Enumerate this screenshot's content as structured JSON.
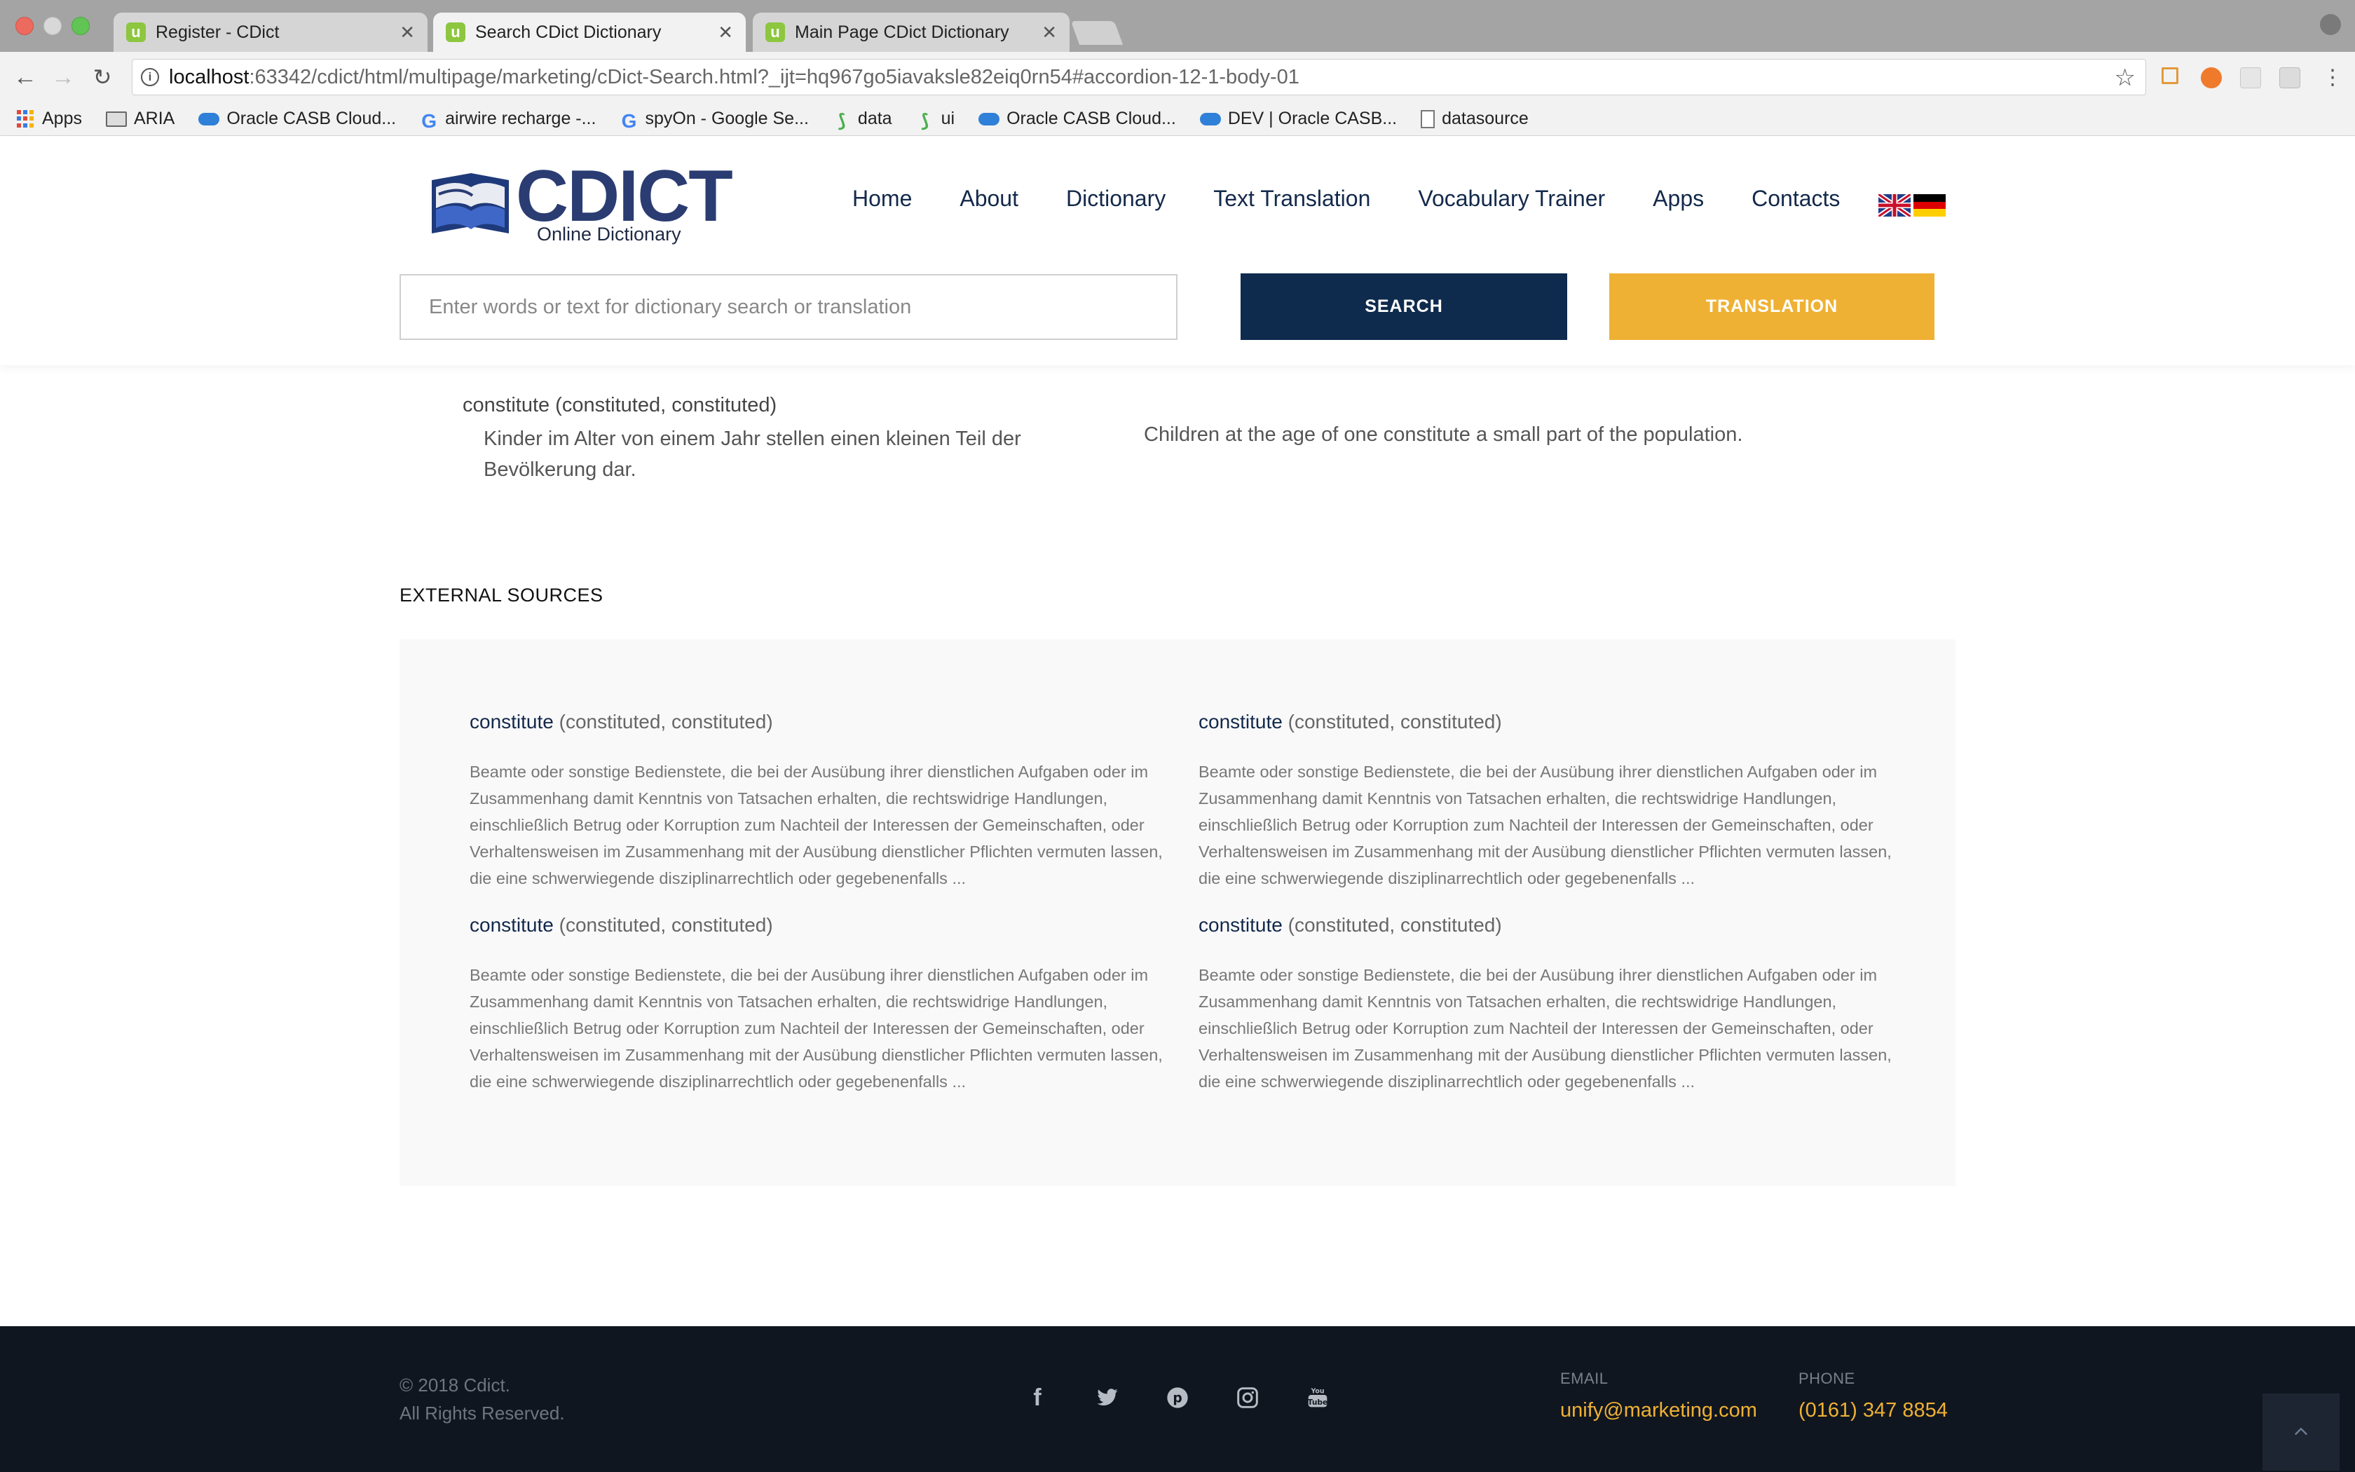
{
  "browser": {
    "tabs": [
      {
        "title": "Register - CDict",
        "active": false
      },
      {
        "title": "Search CDict Dictionary",
        "active": true
      },
      {
        "title": "Main Page CDict Dictionary",
        "active": false
      }
    ],
    "url_host": "localhost",
    "url_rest": ":63342/cdict/html/multipage/marketing/cDict-Search.html?_ijt=hq967go5iavaksle82eiq0rn54#accordion-12-1-body-01",
    "bookmarks": [
      {
        "label": "Apps",
        "icon": "apps-grid-icon"
      },
      {
        "label": "ARIA",
        "icon": "folder-icon"
      },
      {
        "label": "Oracle CASB Cloud...",
        "icon": "cloud-icon"
      },
      {
        "label": "airwire recharge -...",
        "icon": "google-icon"
      },
      {
        "label": "spyOn - Google Se...",
        "icon": "google-icon"
      },
      {
        "label": "data",
        "icon": "gitpod-icon"
      },
      {
        "label": "ui",
        "icon": "gitpod-icon"
      },
      {
        "label": "Oracle CASB Cloud...",
        "icon": "cloud-icon"
      },
      {
        "label": "DEV | Oracle CASB...",
        "icon": "cloud-icon"
      },
      {
        "label": "datasource",
        "icon": "document-icon"
      }
    ]
  },
  "site": {
    "logo_text": "CDICT",
    "logo_sub": "Online Dictionary",
    "nav": [
      "Home",
      "About",
      "Dictionary",
      "Text Translation",
      "Vocabulary Trainer",
      "Apps",
      "Contacts"
    ],
    "search_placeholder": "Enter words or text for dictionary search or translation",
    "search_label": "SEARCH",
    "translation_label": "TRANSLATION"
  },
  "result": {
    "head": "constitute (constituted, constituted)",
    "example_de": "Kinder im Alter von einem Jahr stellen einen kleinen Teil der Bevölkerung dar.",
    "example_en": "Children at the age of one constitute a small part of the population."
  },
  "external": {
    "title": "EXTERNAL SOURCES",
    "items": [
      {
        "word": "constitute",
        "forms": "(constituted, constituted)",
        "body": "Beamte oder sonstige Bedienstete, die bei der Ausübung ihrer dienstlichen Aufgaben oder im Zusammenhang damit Kenntnis von Tatsachen erhalten, die rechtswidrige Handlungen, einschließlich Betrug oder Korruption zum Nachteil der Interessen der Gemeinschaften, oder Verhaltensweisen im Zusammenhang mit der Ausübung dienstlicher Pflichten vermuten lassen, die eine schwerwiegende disziplinarrechtlich oder gegebenenfalls ..."
      },
      {
        "word": "constitute",
        "forms": "(constituted, constituted)",
        "body": "Beamte oder sonstige Bedienstete, die bei der Ausübung ihrer dienstlichen Aufgaben oder im Zusammenhang damit Kenntnis von Tatsachen erhalten, die rechtswidrige Handlungen, einschließlich Betrug oder Korruption zum Nachteil der Interessen der Gemeinschaften, oder Verhaltensweisen im Zusammenhang mit der Ausübung dienstlicher Pflichten vermuten lassen, die eine schwerwiegende disziplinarrechtlich oder gegebenenfalls ..."
      },
      {
        "word": "constitute",
        "forms": "(constituted, constituted)",
        "body": "Beamte oder sonstige Bedienstete, die bei der Ausübung ihrer dienstlichen Aufgaben oder im Zusammenhang damit Kenntnis von Tatsachen erhalten, die rechtswidrige Handlungen, einschließlich Betrug oder Korruption zum Nachteil der Interessen der Gemeinschaften, oder Verhaltensweisen im Zusammenhang mit der Ausübung dienstlicher Pflichten vermuten lassen, die eine schwerwiegende disziplinarrechtlich oder gegebenenfalls ..."
      },
      {
        "word": "constitute",
        "forms": "(constituted, constituted)",
        "body": "Beamte oder sonstige Bedienstete, die bei der Ausübung ihrer dienstlichen Aufgaben oder im Zusammenhang damit Kenntnis von Tatsachen erhalten, die rechtswidrige Handlungen, einschließlich Betrug oder Korruption zum Nachteil der Interessen der Gemeinschaften, oder Verhaltensweisen im Zusammenhang mit der Ausübung dienstlicher Pflichten vermuten lassen, die eine schwerwiegende disziplinarrechtlich oder gegebenenfalls ..."
      }
    ]
  },
  "footer": {
    "copyright": "© 2018 Cdict.",
    "rights": "All Rights Reserved.",
    "socials": [
      "facebook-icon",
      "twitter-icon",
      "pinterest-icon",
      "instagram-icon",
      "youtube-icon"
    ],
    "email_label": "EMAIL",
    "email": "unify@marketing.com",
    "phone_label": "PHONE",
    "phone": "(0161) 347 8854"
  },
  "colors": {
    "navy": "#0e2b4d",
    "accent": "#efb134",
    "footer_bg": "#10161f"
  }
}
